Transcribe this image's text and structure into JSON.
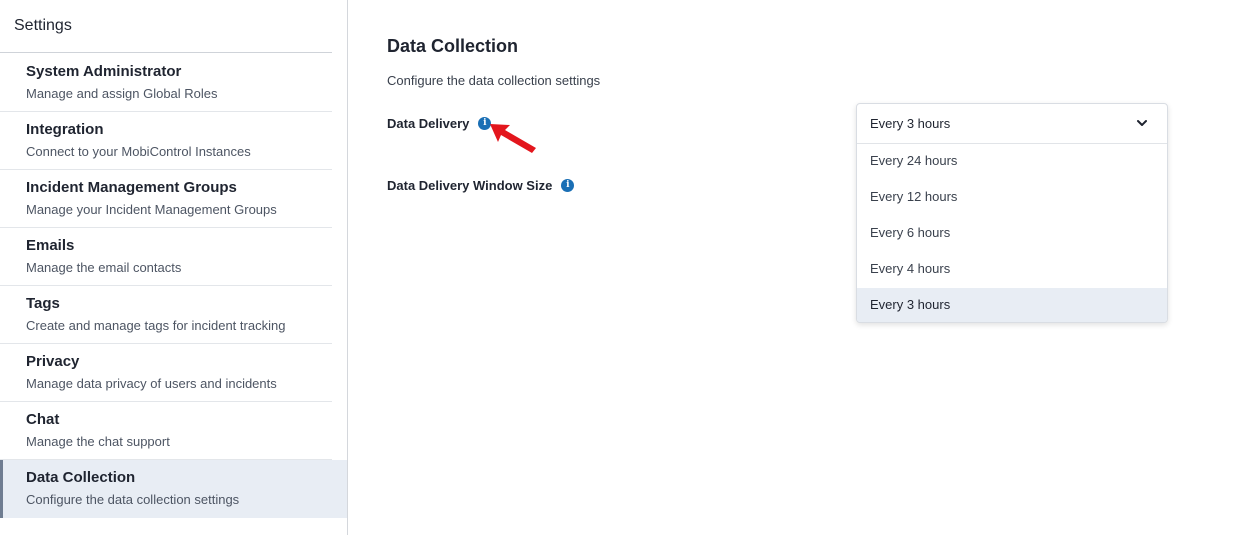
{
  "sidebar": {
    "title": "Settings",
    "items": [
      {
        "title": "System Administrator",
        "subtitle": "Manage and assign Global Roles"
      },
      {
        "title": "Integration",
        "subtitle": "Connect to your MobiControl Instances"
      },
      {
        "title": "Incident Management Groups",
        "subtitle": "Manage your Incident Management Groups"
      },
      {
        "title": "Emails",
        "subtitle": "Manage the email contacts"
      },
      {
        "title": "Tags",
        "subtitle": "Create and manage tags for incident tracking"
      },
      {
        "title": "Privacy",
        "subtitle": "Manage data privacy of users and incidents"
      },
      {
        "title": "Chat",
        "subtitle": "Manage the chat support"
      },
      {
        "title": "Data Collection",
        "subtitle": "Configure the data collection settings"
      }
    ],
    "active_item": "Data Collection"
  },
  "main": {
    "title": "Data Collection",
    "description": "Configure the data collection settings",
    "fields": {
      "data_delivery": {
        "label": "Data Delivery",
        "info_icon": "info-icon"
      },
      "window_size": {
        "label": "Data Delivery Window Size",
        "info_icon": "info-icon"
      }
    }
  },
  "dropdown": {
    "selected": "Every 3 hours",
    "options": [
      "Every 24 hours",
      "Every 12 hours",
      "Every 6 hours",
      "Every 4 hours",
      "Every 3 hours"
    ],
    "icon": "chevron-down-icon"
  },
  "annotation": {
    "icon": "red-arrow-pointer",
    "color": "#e3161d"
  },
  "colors": {
    "info_icon": "#1a6fb5",
    "active_bg": "#e8edf4",
    "active_border": "#6f7d91"
  }
}
